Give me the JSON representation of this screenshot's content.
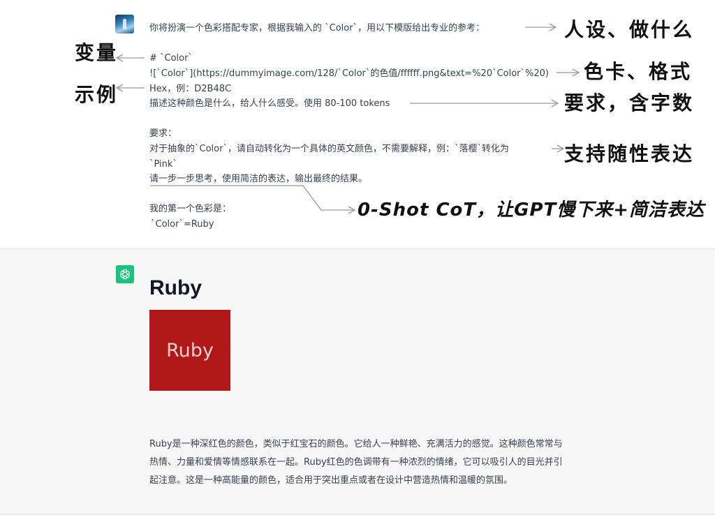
{
  "user_prompt": {
    "line1": "你将扮演一个色彩搭配专家，根据我输入的 `Color`，用以下模版给出专业的参考：",
    "line2": "# `Color`",
    "line3": "![`Color`](https://dummyimage.com/128/`Color`的色值/ffffff.png&text=%20`Color`%20)",
    "line4": "Hex，例：D2B48C",
    "line5": "描述这种颜色是什么，给人什么感受。使用 80-100 tokens",
    "line6": "要求：",
    "line7": "对于抽象的`Color`，请自动转化为一个具体的英文颜色，不需要解释，例：`落樱`转化为",
    "line8": "`Pink`",
    "line9": "请一步一步思考，使用简洁的表达，输出最终的结果。",
    "line10": "我的第一个色彩是：",
    "line11": "`Color`=Ruby"
  },
  "annotations": {
    "persona": "人设、做什么",
    "variable": "变量",
    "color_card_format": "色卡、格式",
    "example": "示例",
    "requirement": "要求，含字数",
    "flexible": "支持随性表达",
    "cot": "0-Shot CoT，让GPT慢下来+简洁表达"
  },
  "answer": {
    "title": "Ruby",
    "color_card_text": "Ruby",
    "color_card_hex": "#B01716",
    "description": "Ruby是一种深红色的颜色，类似于红宝石的颜色。它给人一种鲜艳、充满活力的感觉。这种颜色常常与热情、力量和爱情等情感联系在一起。Ruby红色的色调带有一种浓烈的情绪，它可以吸引人的目光并引起注意。这是一种高能量的颜色，适合用于突出重点或者在设计中营造热情和温暖的氛围。"
  },
  "colors": {
    "assistant_bg": "#F7F7F8",
    "gpt_icon_bg": "#19C37D",
    "arrow": "#999999"
  }
}
